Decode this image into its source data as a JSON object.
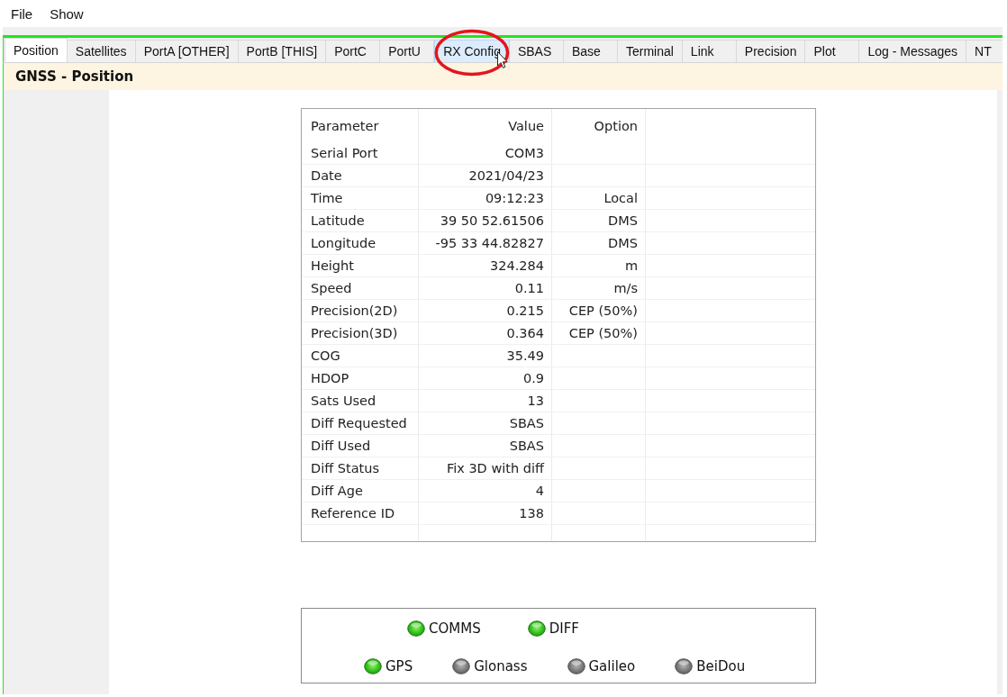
{
  "menu_bar": {
    "items": [
      "File",
      "Show"
    ]
  },
  "tabs": [
    {
      "label": "Position",
      "selected": true,
      "hovered": false,
      "circled": false
    },
    {
      "label": "Satellites",
      "selected": false,
      "hovered": false,
      "circled": false
    },
    {
      "label": "PortA [OTHER]",
      "selected": false,
      "hovered": false,
      "circled": false
    },
    {
      "label": "PortB [THIS]",
      "selected": false,
      "hovered": false,
      "circled": false
    },
    {
      "label": "PortC",
      "selected": false,
      "hovered": false,
      "circled": false
    },
    {
      "label": "PortU",
      "selected": false,
      "hovered": false,
      "circled": false
    },
    {
      "label": "RX Config",
      "selected": false,
      "hovered": true,
      "circled": true
    },
    {
      "label": "SBAS",
      "selected": false,
      "hovered": false,
      "circled": false
    },
    {
      "label": "Base",
      "selected": false,
      "hovered": false,
      "circled": false
    },
    {
      "label": "Terminal",
      "selected": false,
      "hovered": false,
      "circled": false
    },
    {
      "label": "Link",
      "selected": false,
      "hovered": false,
      "circled": false
    },
    {
      "label": "Precision",
      "selected": false,
      "hovered": false,
      "circled": false
    },
    {
      "label": "Plot",
      "selected": false,
      "hovered": false,
      "circled": false
    },
    {
      "label": "Log - Messages",
      "selected": false,
      "hovered": false,
      "circled": false
    },
    {
      "label": "NT",
      "selected": false,
      "hovered": false,
      "circled": false
    }
  ],
  "panel": {
    "title": "GNSS - Position"
  },
  "table": {
    "columns": [
      "Parameter",
      "Value",
      "Option"
    ],
    "rows": [
      {
        "parameter": "Serial Port",
        "value": "COM3"
      },
      {
        "parameter": "Date",
        "value": "2021/04/23"
      },
      {
        "parameter": "Time",
        "value": "09:12:23",
        "option": "Local"
      },
      {
        "parameter": "Latitude",
        "value": "39 50 52.61506",
        "option": "DMS"
      },
      {
        "parameter": "Longitude",
        "value": "-95 33 44.82827",
        "option": "DMS"
      },
      {
        "parameter": "Height",
        "value": "324.284",
        "option": "m"
      },
      {
        "parameter": "Speed",
        "value": "0.11",
        "option": "m/s"
      },
      {
        "parameter": "Precision(2D)",
        "value": "0.215",
        "option": "CEP (50%)"
      },
      {
        "parameter": "Precision(3D)",
        "value": "0.364",
        "option": "CEP (50%)"
      },
      {
        "parameter": "COG",
        "value": "35.49"
      },
      {
        "parameter": "HDOP",
        "value": "0.9"
      },
      {
        "parameter": "Sats Used",
        "value": "13"
      },
      {
        "parameter": "Diff Requested",
        "value": "SBAS"
      },
      {
        "parameter": "Diff Used",
        "value": "SBAS"
      },
      {
        "parameter": "Diff Status",
        "value": "Fix 3D with diff"
      },
      {
        "parameter": "Diff Age",
        "value": "4"
      },
      {
        "parameter": "Reference ID",
        "value": "138"
      }
    ]
  },
  "status_lights": {
    "rows": [
      {
        "items": [
          {
            "label": "COMMS",
            "on": true
          },
          {
            "label": "DIFF",
            "on": true
          }
        ]
      },
      {
        "items": [
          {
            "label": "GPS",
            "on": true
          },
          {
            "label": "Glonass",
            "on": false
          },
          {
            "label": "Galileo",
            "on": false
          },
          {
            "label": "BeiDou",
            "on": false
          }
        ]
      }
    ]
  }
}
